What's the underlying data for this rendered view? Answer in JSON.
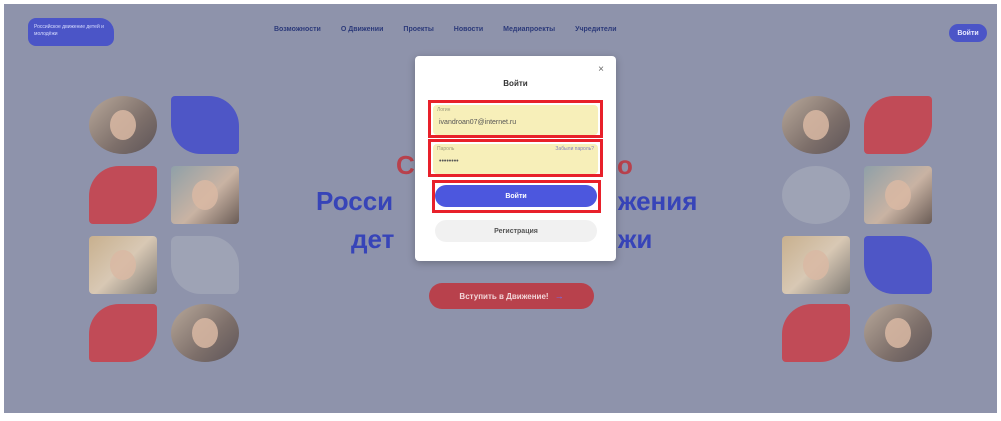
{
  "header": {
    "logo_text": "Российское движение детей и молодёжи",
    "nav": [
      "Возможности",
      "О Движении",
      "Проекты",
      "Новости",
      "Медиапроекты",
      "Учредители"
    ],
    "login_button": "Войти"
  },
  "hero": {
    "line1": "С",
    "line1_end": "о",
    "line2_left": "Росси",
    "line2_right": "жения",
    "line3_left": "дет",
    "line3_right": "жи",
    "cta_label": "Вступить в Движение!",
    "cta_icon": "→"
  },
  "modal": {
    "title": "Войти",
    "close_icon": "×",
    "login_label": "Логин",
    "login_value": "ivandroan07@internet.ru",
    "password_label": "Пароль",
    "password_value": "••••••••",
    "forgot_password": "Забыли пароль?",
    "submit_label": "Войти",
    "register_label": "Регистрация"
  },
  "colors": {
    "overlay": "#8e93ab",
    "brand_blue": "#4b55c7",
    "brand_red": "#c14b57",
    "highlight": "#e8202a",
    "field_bg": "#f7efb9"
  }
}
